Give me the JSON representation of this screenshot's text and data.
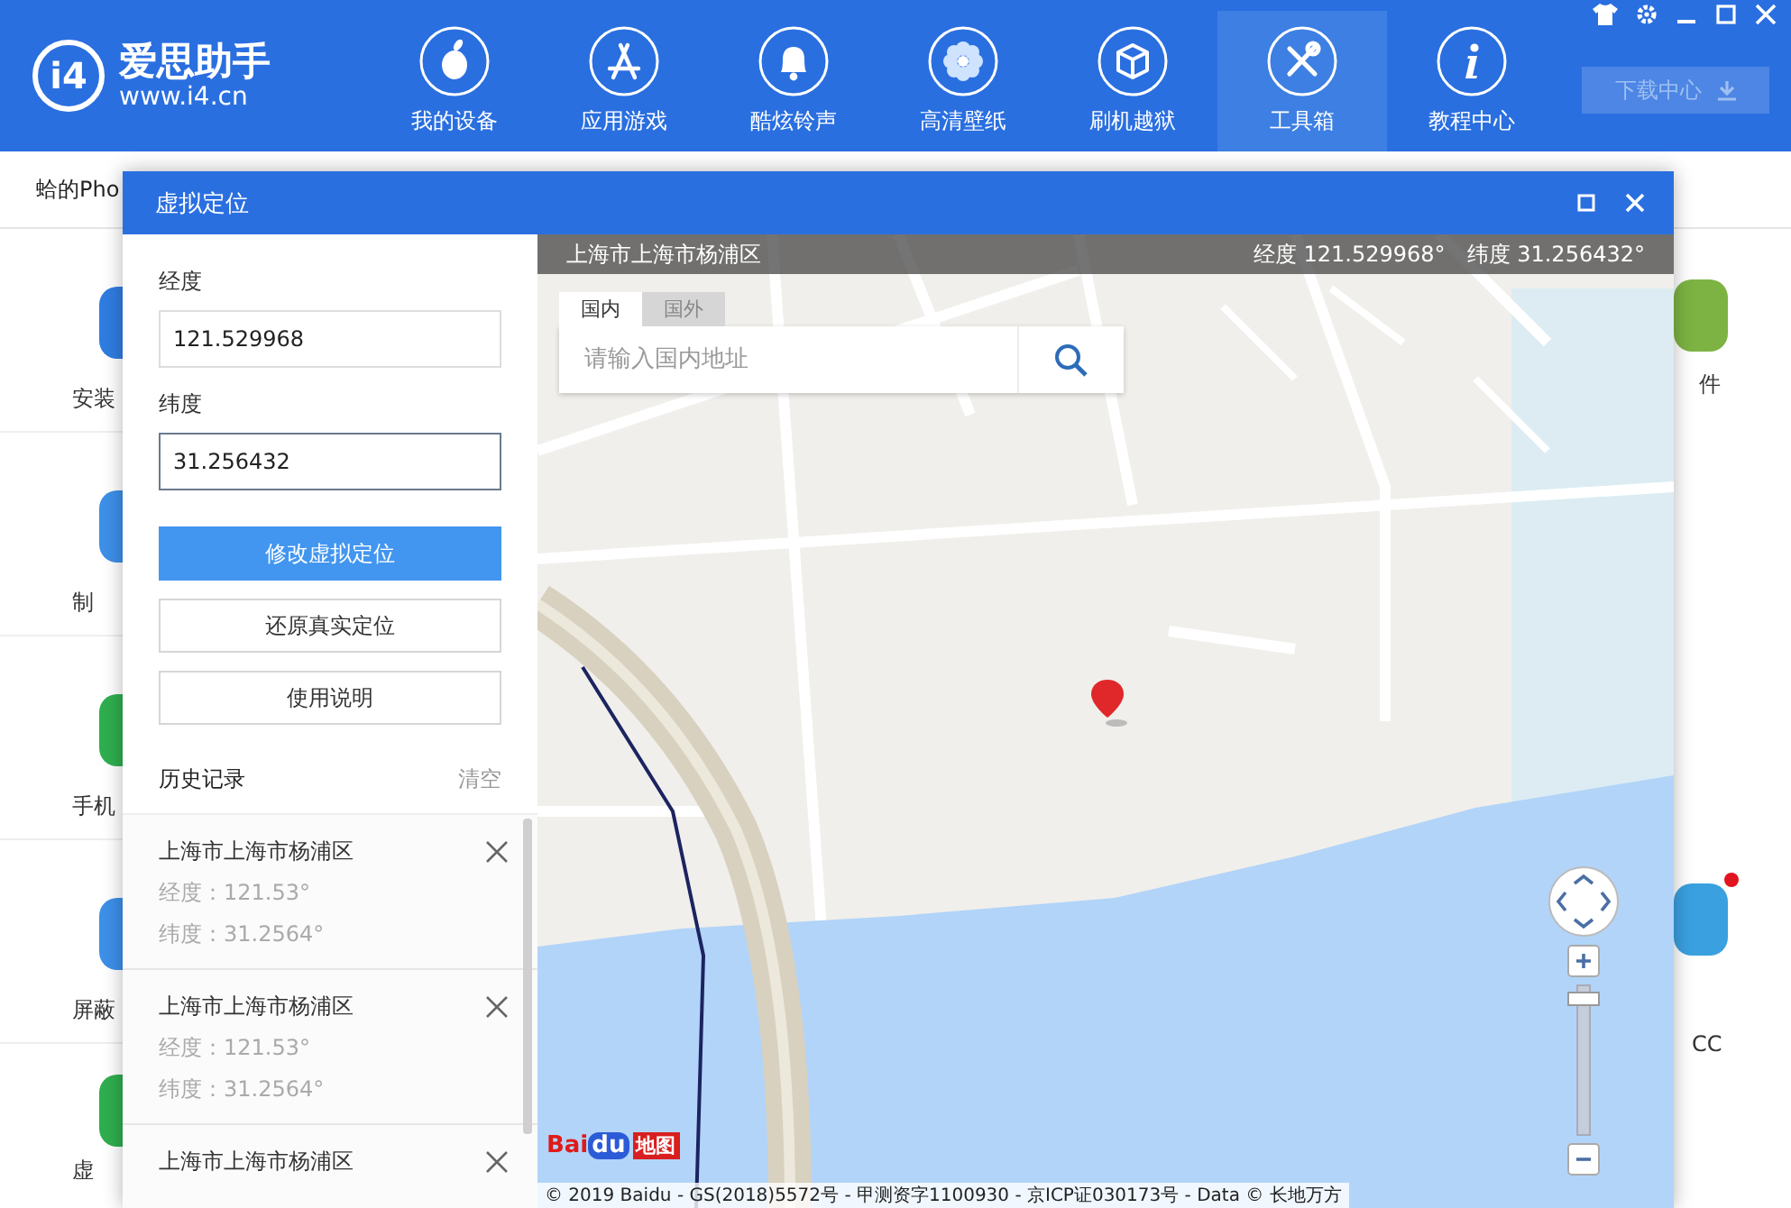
{
  "app_header": {
    "logo_mark": "i4",
    "app_name": "爱思助手",
    "app_url": "www.i4.cn",
    "nav": [
      {
        "label": "我的设备",
        "selected": false
      },
      {
        "label": "应用游戏",
        "selected": false
      },
      {
        "label": "酷炫铃声",
        "selected": false
      },
      {
        "label": "高清壁纸",
        "selected": false
      },
      {
        "label": "刷机越狱",
        "selected": false
      },
      {
        "label": "工具箱",
        "selected": true
      },
      {
        "label": "教程中心",
        "selected": false
      }
    ],
    "download_button": {
      "label": "下载中心",
      "disabled": true
    }
  },
  "background": {
    "device_tab": "蛤的Pho",
    "left_tools": [
      {
        "label": "安装",
        "color": "#2f7de0"
      },
      {
        "label": "制",
        "color": "#3d8fe8"
      },
      {
        "label": "手机",
        "color": "#2fae4f"
      },
      {
        "label": "屏蔽",
        "color": "#3d8fe8"
      },
      {
        "label": "虚",
        "color": "#2fae4f"
      }
    ],
    "right_tools": [
      {
        "label": "件",
        "color": "#7cb342",
        "badge": false
      },
      {
        "label": "CC",
        "color": "#3aa0e0",
        "badge": true
      }
    ]
  },
  "dialog": {
    "title": "虚拟定位",
    "fields": [
      {
        "label": "经度",
        "value": "121.529968",
        "focused": false
      },
      {
        "label": "纬度",
        "value": "31.256432",
        "focused": true
      }
    ],
    "buttons": [
      {
        "label": "修改虚拟定位",
        "kind": "primary"
      },
      {
        "label": "还原真实定位",
        "kind": "default"
      },
      {
        "label": "使用说明",
        "kind": "default"
      }
    ],
    "history": {
      "title": "历史记录",
      "clear": "清空",
      "items": [
        {
          "name": "上海市上海市杨浦区",
          "longitude": "经度：121.53°",
          "latitude": "纬度：31.2564°"
        },
        {
          "name": "上海市上海市杨浦区",
          "longitude": "经度：121.53°",
          "latitude": "纬度：31.2564°"
        },
        {
          "name": "上海市上海市杨浦区"
        }
      ]
    },
    "map": {
      "location_bar": {
        "address": "上海市上海市杨浦区",
        "longitude": "经度 121.529968°",
        "latitude": "纬度 31.256432°"
      },
      "search": {
        "tabs": [
          {
            "label": "国内",
            "selected": true
          },
          {
            "label": "国外",
            "selected": false
          }
        ],
        "placeholder": "请输入国内地址"
      },
      "zoom": {
        "level": 0.95
      },
      "logo_parts": [
        "Bai",
        "du",
        "地图"
      ],
      "copyright": "© 2019 Baidu - GS(2018)5572号 - 甲测资字1100930 - 京ICP证030173号 - Data © 长地万方"
    }
  }
}
